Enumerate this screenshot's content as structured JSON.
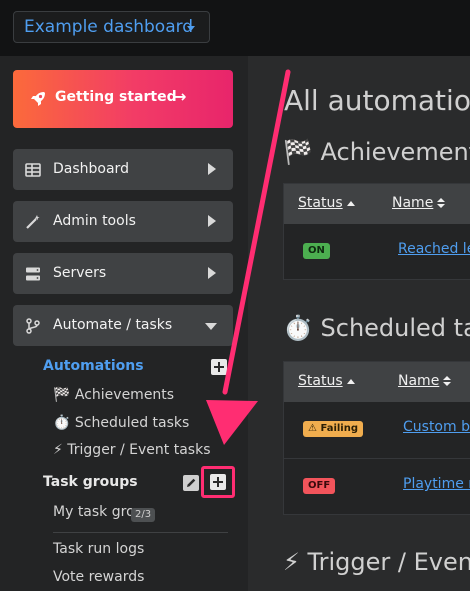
{
  "topbar": {
    "dashboard_select": "Example dashboard"
  },
  "sidebar": {
    "getting_started": "Getting started",
    "nav": [
      {
        "label": "Dashboard",
        "icon": "table-icon"
      },
      {
        "label": "Admin tools",
        "icon": "magic-wand-icon"
      },
      {
        "label": "Servers",
        "icon": "server-icon"
      },
      {
        "label": "Automate / tasks",
        "icon": "branch-icon"
      }
    ],
    "automations": {
      "heading": "Automations",
      "items": [
        "🏁 Achievements",
        "⏱️ Scheduled tasks",
        "⚡ Trigger / Event tasks"
      ]
    },
    "task_groups": {
      "heading": "Task groups",
      "items": [
        {
          "label": "My task group",
          "badge": "2/3"
        }
      ]
    },
    "extra_links": [
      "Task run logs",
      "Vote rewards"
    ]
  },
  "main": {
    "title": "All automation",
    "sections": [
      {
        "heading": "🏁 Achievements",
        "columns": [
          "Status",
          "Name"
        ],
        "rows": [
          {
            "status": "ON",
            "name": "Reached le"
          }
        ]
      },
      {
        "heading": "⏱️ Scheduled tas",
        "columns": [
          "Status",
          "Name"
        ],
        "rows": [
          {
            "status": "⚠ Failing",
            "name": "Custom ba"
          },
          {
            "status": "OFF",
            "name": "Playtime r"
          }
        ]
      },
      {
        "heading": "⚡ Trigger / Even"
      }
    ]
  },
  "colors": {
    "accent": "#4f9ef0",
    "highlight": "#ff2d72",
    "on_badge": "#4caf50",
    "off_badge": "#f2545b",
    "failing_badge": "#f0ad4e"
  }
}
